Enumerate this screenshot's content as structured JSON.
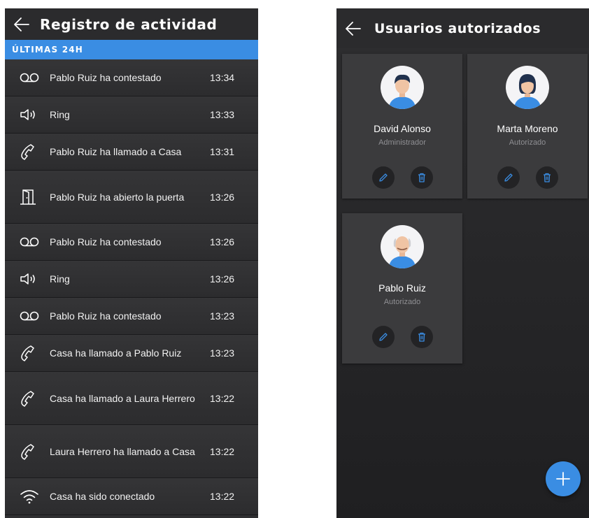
{
  "activity_log": {
    "title": "Registro de actividad",
    "section": "ÚLTIMAS 24H",
    "entries": [
      {
        "icon": "voicemail-icon",
        "text": "Pablo Ruiz ha contestado",
        "time": "13:34"
      },
      {
        "icon": "speaker-icon",
        "text": "Ring",
        "time": "13:33"
      },
      {
        "icon": "phone-icon",
        "text": "Pablo Ruiz ha llamado a Casa",
        "time": "13:31"
      },
      {
        "icon": "door-icon",
        "text": "Pablo Ruiz ha abierto la puerta",
        "time": "13:26"
      },
      {
        "icon": "voicemail-icon",
        "text": "Pablo Ruiz ha contestado",
        "time": "13:26"
      },
      {
        "icon": "speaker-icon",
        "text": "Ring",
        "time": "13:26"
      },
      {
        "icon": "voicemail-icon",
        "text": "Pablo Ruiz ha contestado",
        "time": "13:23"
      },
      {
        "icon": "phone-icon",
        "text": "Casa ha llamado a Pablo Ruiz",
        "time": "13:23"
      },
      {
        "icon": "phone-icon",
        "text": "Casa ha llamado a Laura Herrero",
        "time": "13:22"
      },
      {
        "icon": "phone-icon",
        "text": "Laura Herrero ha llamado a Casa",
        "time": "13:22"
      },
      {
        "icon": "wifi-icon",
        "text": "Casa ha sido conectado",
        "time": "13:22"
      }
    ]
  },
  "authorized_users": {
    "title": "Usuarios autorizados",
    "users": [
      {
        "name": "David Alonso",
        "role": "Administrador",
        "avatar": "male-avatar-icon"
      },
      {
        "name": "Marta Moreno",
        "role": "Autorizado",
        "avatar": "female-avatar-icon"
      },
      {
        "name": "Pablo Ruiz",
        "role": "Autorizado",
        "avatar": "elder-male-avatar-icon"
      }
    ],
    "add_icon": "plus-icon"
  },
  "colors": {
    "accent": "#3a8de3",
    "background": "#2f2f31",
    "card": "#3b3b3d",
    "shirt": "#3a8de3"
  }
}
